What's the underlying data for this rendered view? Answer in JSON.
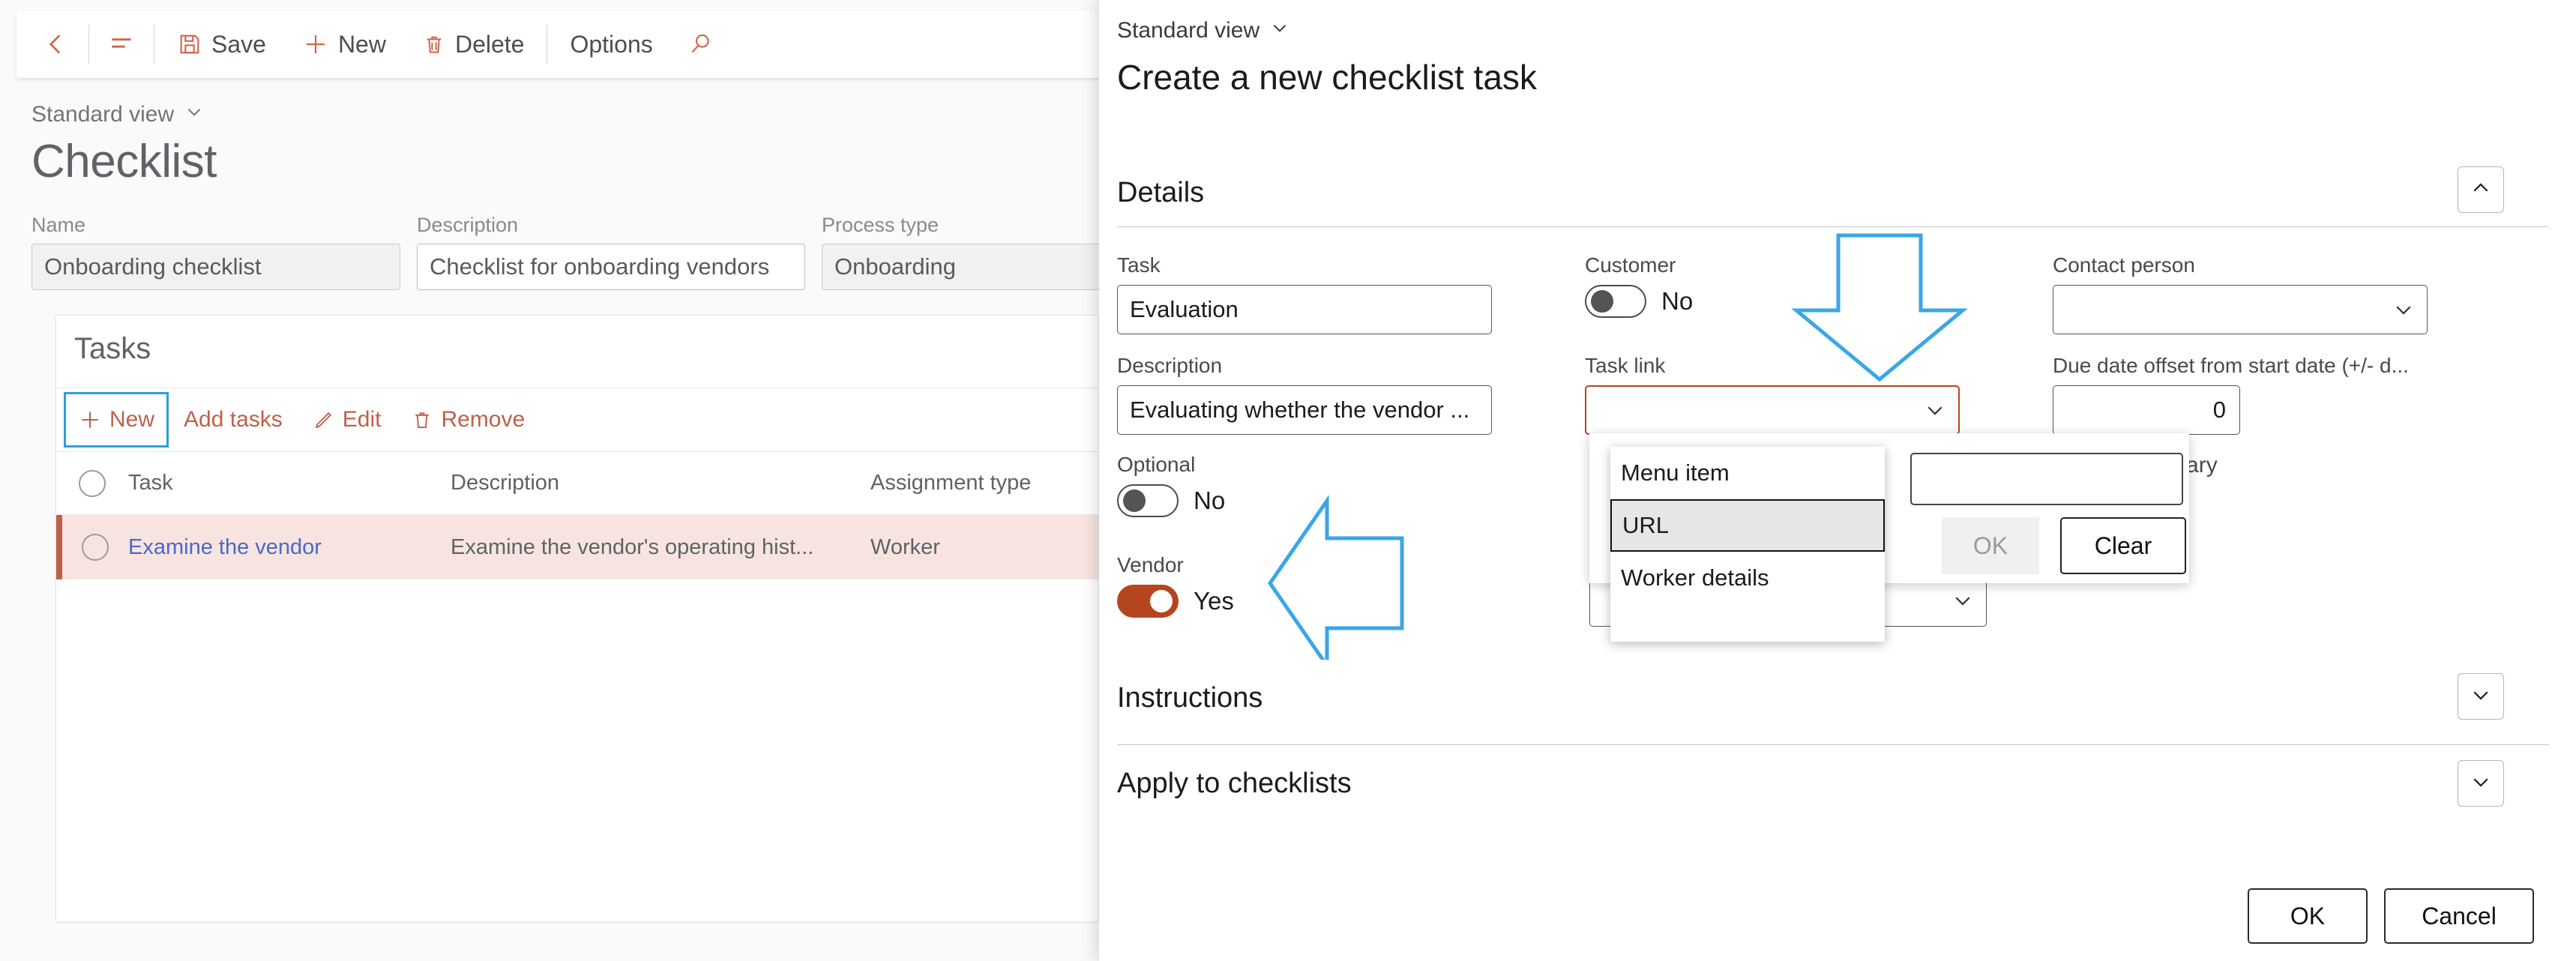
{
  "colors": {
    "accent_orange": "#c0604a",
    "toggle_on": "#b4451f",
    "annotation_blue": "#3aa6e8",
    "row_selected_bg": "#f7e4e0",
    "link_blue": "#4a68c8"
  },
  "left_app": {
    "toolbar": {
      "back_icon": "arrow-left-icon",
      "menu_icon": "hamburger-icon",
      "items": [
        {
          "label": "Save",
          "icon": "save-icon"
        },
        {
          "label": "New",
          "icon": "plus-icon"
        },
        {
          "label": "Delete",
          "icon": "trash-icon"
        },
        {
          "label": "Options",
          "icon": ""
        }
      ],
      "search_icon": "search-icon"
    },
    "view_switch": "Standard view",
    "page_title": "Checklist",
    "header_fields": [
      {
        "label": "Name",
        "value": "Onboarding checklist",
        "readonly": true
      },
      {
        "label": "Description",
        "value": "Checklist for onboarding vendors",
        "readonly": false
      },
      {
        "label": "Process type",
        "value": "Onboarding",
        "readonly": true
      }
    ],
    "tasks": {
      "title": "Tasks",
      "actions": [
        {
          "label": "New",
          "icon": "plus-icon",
          "focused": true
        },
        {
          "label": "Add tasks",
          "icon": ""
        },
        {
          "label": "Edit",
          "icon": "pencil-icon"
        },
        {
          "label": "Remove",
          "icon": "trash-icon"
        }
      ],
      "columns": [
        "Task",
        "Description",
        "Assignment type"
      ],
      "rows": [
        {
          "task": "Examine the vendor",
          "description": "Examine the vendor's operating hist...",
          "assignment_type": "Worker"
        }
      ]
    }
  },
  "dialog": {
    "view_switch": "Standard view",
    "title": "Create a new checklist task",
    "sections": [
      {
        "label": "Details",
        "expanded": true,
        "chevron": "chevron-up-icon"
      },
      {
        "label": "Instructions",
        "expanded": false,
        "chevron": "chevron-down-icon"
      },
      {
        "label": "Apply to checklists",
        "expanded": false,
        "chevron": "chevron-down-icon"
      }
    ],
    "details": {
      "task": {
        "label": "Task",
        "value": "Evaluation"
      },
      "description": {
        "label": "Description",
        "value": "Evaluating whether the vendor ..."
      },
      "optional": {
        "label": "Optional",
        "value": "No",
        "on": false
      },
      "vendor": {
        "label": "Vendor",
        "value": "Yes",
        "on": true
      },
      "customer": {
        "label": "Customer",
        "value": "No",
        "on": false
      },
      "task_link": {
        "label": "Task link",
        "value": ""
      },
      "contact_person": {
        "label": "Contact person",
        "value": ""
      },
      "due_date_offset": {
        "label": "Due date offset from start date (+/- d...",
        "value": "0"
      },
      "library_text": "the library"
    },
    "lookup": {
      "combo_value": "URL",
      "text_value": "",
      "ok_label": "OK",
      "clear_label": "Clear",
      "options": [
        "Menu item",
        "URL",
        "Worker details"
      ],
      "selected_option": "URL"
    },
    "footer": {
      "ok_label": "OK",
      "cancel_label": "Cancel"
    }
  },
  "annotations": [
    {
      "name": "arrow-down-to-task-link",
      "direction": "down"
    },
    {
      "name": "arrow-left-to-vendor-toggle",
      "direction": "left"
    }
  ]
}
